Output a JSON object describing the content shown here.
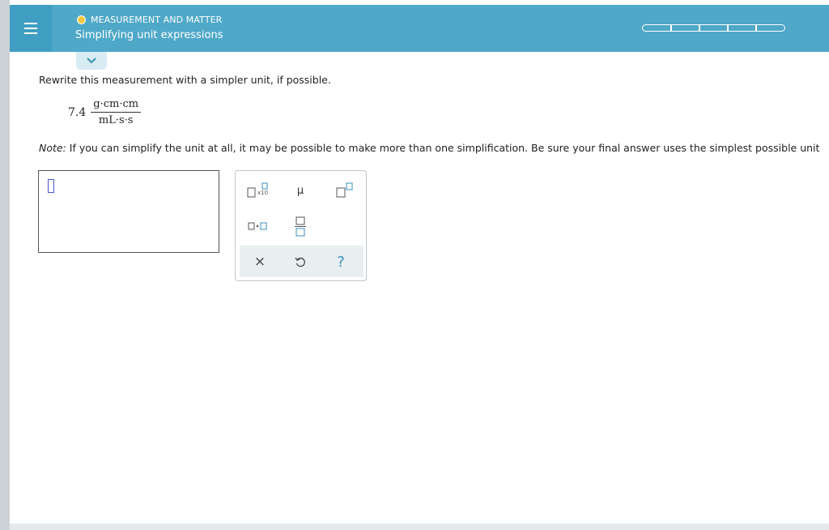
{
  "header": {
    "topic": "MEASUREMENT AND MATTER",
    "title": "Simplifying unit expressions",
    "colors": {
      "bar": "#4fa8c8",
      "menu": "#3f9ec2",
      "topic_dot": "#f5c842"
    },
    "progress_segments": 5
  },
  "question": {
    "prompt": "Rewrite this measurement with a simpler unit, if possible.",
    "coefficient": "7.4",
    "numerator": "g·cm·cm",
    "denominator": "mL·s·s",
    "note_label": "Note:",
    "note_text": " If you can simplify the unit at all, it may be possible to make more than one simplification. Be sure your final answer uses the simplest possible unit"
  },
  "answer": {
    "value": ""
  },
  "keypad": {
    "sci_label": "x10",
    "mu_label": "μ",
    "clear_label": "×",
    "help_label": "?"
  },
  "icons": {
    "menu": "hamburger-icon",
    "collapse": "chevron-down-icon",
    "undo": "undo-icon"
  }
}
